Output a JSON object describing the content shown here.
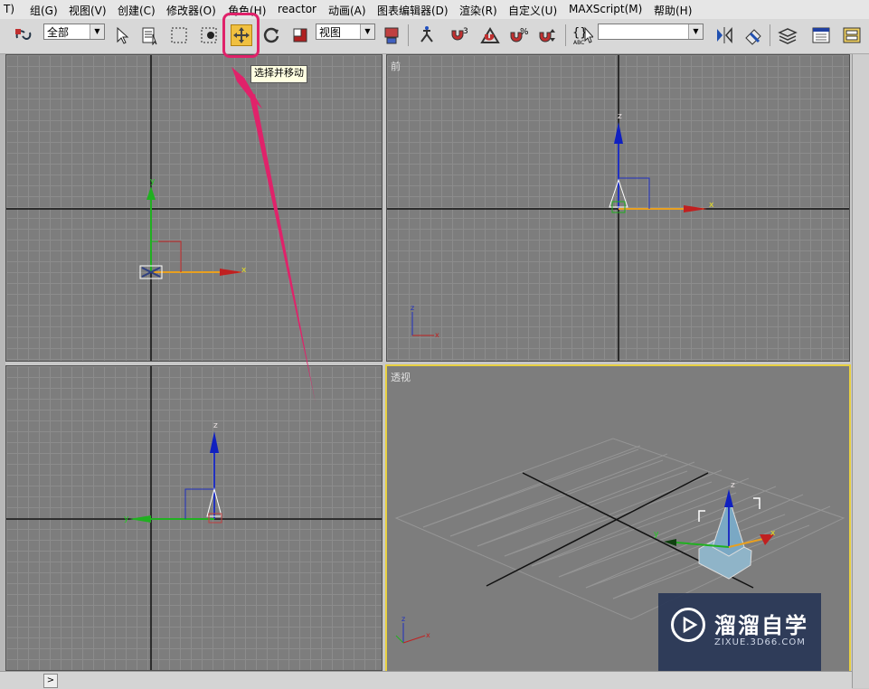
{
  "menubar": {
    "items": [
      {
        "label": "T)"
      },
      {
        "label": "组(G)"
      },
      {
        "label": "视图(V)"
      },
      {
        "label": "创建(C)"
      },
      {
        "label": "修改器(O)"
      },
      {
        "label": "角色(H)"
      },
      {
        "label": "reactor"
      },
      {
        "label": "动画(A)"
      },
      {
        "label": "图表编辑器(D)"
      },
      {
        "label": "渲染(R)"
      },
      {
        "label": "自定义(U)"
      },
      {
        "label": "MAXScript(M)"
      },
      {
        "label": "帮助(H)"
      }
    ]
  },
  "toolbar": {
    "selection_filter": "全部",
    "reference_coord": "视图",
    "named_selection": "",
    "tooltip": "选择并移动",
    "highlight_color": "#e0226a",
    "active_tool": "select-and-move"
  },
  "viewports": {
    "top_left": {
      "label": ""
    },
    "front": {
      "label": "前"
    },
    "bottom_left": {
      "label": ""
    },
    "perspective": {
      "label": "透视"
    }
  },
  "axis_labels": {
    "x": "x",
    "y": "y",
    "z": "z"
  },
  "statusbar": {
    "nav": ">"
  },
  "watermark": {
    "title": "溜溜自学",
    "url": "ZIXUE.3D66.COM"
  }
}
